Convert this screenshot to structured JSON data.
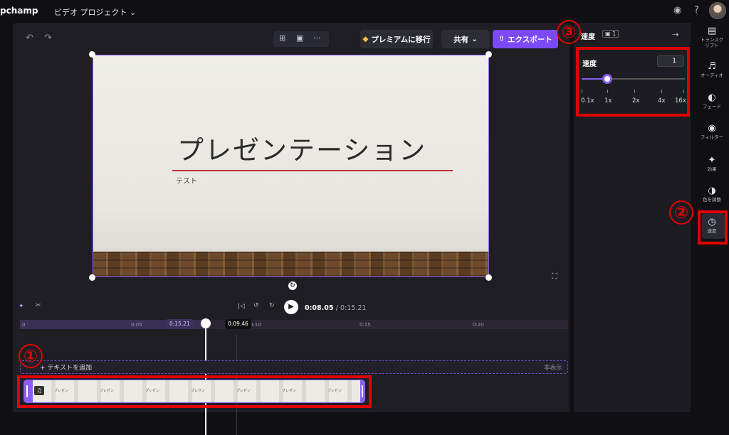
{
  "topbar": {
    "logo": "pchamp",
    "project_name": "ビデオ プロジェクト ⌄",
    "help_icon": "?"
  },
  "toolbar": {
    "premium_label": "プレミアムに移行",
    "share_label": "共有",
    "export_label": "エクスポート",
    "more_label": "···"
  },
  "slide": {
    "title": "プレゼンテーション",
    "subtitle": "テスト"
  },
  "playback": {
    "current_time": "0:08.05",
    "total_time": "/ 0:15.21"
  },
  "timeline": {
    "ticks": [
      "0",
      "0:05",
      "0:10",
      "0:15",
      "0:20"
    ],
    "clip_end_badge": "0:15.21",
    "playhead_badge": "0:09.46",
    "add_text_label": "+ テキストを追加",
    "hide_label": "非表示",
    "thumb_text": "プレゼン"
  },
  "panel": {
    "title": "速度",
    "clip_badge": "▣ 1",
    "speed_label": "速度",
    "speed_value": "1",
    "speed_fraction": 0.25,
    "slider_labels": [
      "0.1x",
      "1x",
      "2x",
      "4x",
      "16x"
    ]
  },
  "rail": {
    "items": [
      {
        "label": "トランスク\nリプト",
        "icon": "transcript-icon"
      },
      {
        "label": "オーディオ",
        "icon": "audio-icon"
      },
      {
        "label": "フェード",
        "icon": "fade-icon"
      },
      {
        "label": "フィルター",
        "icon": "filter-icon"
      },
      {
        "label": "効果",
        "icon": "effects-icon"
      },
      {
        "label": "色を調整",
        "icon": "color-adjust-icon"
      },
      {
        "label": "速度",
        "icon": "speed-icon"
      }
    ]
  },
  "annotations": [
    "①",
    "②",
    "③"
  ],
  "colors": {
    "accent": "#8b5cf6",
    "highlight": "#e00000",
    "slide_line": "#c0303f"
  }
}
